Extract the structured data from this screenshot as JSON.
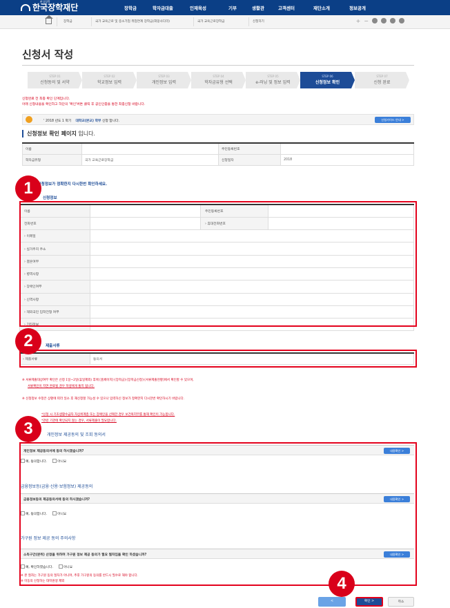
{
  "header": {
    "logo_small": "한국장학",
    "logo": "한국장학재단",
    "menu": [
      "장학금",
      "학자금대출",
      "인재육성",
      "기부",
      "생활관",
      "고객센터",
      "재단소개",
      "정보공개"
    ]
  },
  "breadcrumb": {
    "items": [
      "장학금",
      "국가 교육근로 및 중소기업 취업연계 장학금(희망사다리)",
      "국가 교육근로장학금",
      "신청하기"
    ],
    "tools": [
      "+",
      "−"
    ]
  },
  "page_title": "신청서 작성",
  "steps": [
    {
      "num": "STEP 01",
      "label": "신청동의 및 서약"
    },
    {
      "num": "STEP 02",
      "label": "학교정보 입력"
    },
    {
      "num": "STEP 03",
      "label": "개인정보 입력"
    },
    {
      "num": "STEP 04",
      "label": "학자금유형 선택"
    },
    {
      "num": "STEP 05",
      "label": "e-러닝 및 정보 입력"
    },
    {
      "num": "STEP 06",
      "label": "신청정보 확인"
    },
    {
      "num": "STEP 07",
      "label": "신청 완료"
    }
  ],
  "red_notice": {
    "line1": "신청완료 전 최종 확인 단계입니다.",
    "line2": "아래 신청내용을 확인하고 하단의 '확인'버튼 클릭 후 공인인증을 통한 최종신청 바랍니다."
  },
  "info_bar": {
    "prefix": "' 2018 년도 1 학기",
    "school": "대학교(본교) 학부",
    "suffix": "신청 합니다.",
    "guide_button": "신청가이드 안내 >"
  },
  "section_title": {
    "bold": "신청정보 확인 페이지",
    "rest": " 입니다."
  },
  "summary": {
    "name_label": "이름",
    "ssn_label": "주민등록번호",
    "type_label": "학자금유형",
    "type_value": "국가 교육근로장학금",
    "date_label": "신청일자",
    "date_value": "2018"
  },
  "confirm_prompt": "입력하신 신청정보가 정확한지 다시한번 확인하세요.",
  "personal_title": "신청정보",
  "personal": {
    "name": "이름",
    "ssn": "주민등록번호",
    "phone": "전화번호",
    "mobile": "휴대전화번호",
    "rows": [
      "이메일",
      "실거주지 주소",
      "결혼여부",
      "병역사항",
      "장애인여부",
      "신역사항",
      "재외국민 입학전형 여부",
      "기타정보"
    ]
  },
  "docs_title": "제출서류",
  "docs": {
    "label": "제출서류",
    "value": "동의서"
  },
  "notes": [
    "※ 서류제출대상여부 확인은 신청 1일~2일(휴일제외) 후에 [홈페이지]-[장학금]-[장학금신청]-[서류제출현황]에서 확인할 수 있으며,",
    "서류확인이 지연 완료될 경우 학생에게 통지 됩니다.",
    "※ 신청정보 수정은 상황에 따라 일소 후 재신청할 가능성 수 있으나 입력하신 정보가 정확한지 다시한번 확인하시기 바랍니다.",
    "*신청 시 기초생활수급자 자상위계층 또는 장애인을 선택한 경우 보건복지부를 통해 확인이 가능합니다.",
    "*관련 기관에 확인되지 않는 경우, 서류제출이 필요합니다."
  ],
  "agree_title": "개인정보 제공동의 및 조회 동의서",
  "agree": [
    {
      "question": "개인정보 제공동의서에 동의 하시겠습니까?",
      "button": "내용확인 >",
      "yes": "예, 동의합니다.",
      "no": "아니요"
    },
    {
      "question": "금융정보등의 제공동의서에 동의 하시겠습니까?",
      "button": "내용확인 >",
      "yes": "예, 동의합니다.",
      "no": "아니요"
    },
    {
      "question": "소득구간(분위) 산정을 위하여 가구원 정보 제공 동의가 필요 절차임을 확인 하셨습니까?",
      "button": "내용확인 >",
      "yes": "예, 확인하였습니다.",
      "no": "아니요"
    }
  ],
  "finance_title": "금융정보등(금융·신용·보험정보) 제공동의",
  "family_title": "가구원 정보 제공 동의 주의사항",
  "bottom_notes": [
    "※ 본 절차는 가구원 동의 절차가 아니며, 추후 가구원의 동의를 반드시 필수로 해야 합니다.",
    "※ 미동의 신청하는 대학원생 제외"
  ],
  "badges": [
    "1",
    "2",
    "3",
    "4"
  ],
  "buttons": {
    "prev": "<",
    "ok": "확인 >",
    "cancel": "취소"
  }
}
